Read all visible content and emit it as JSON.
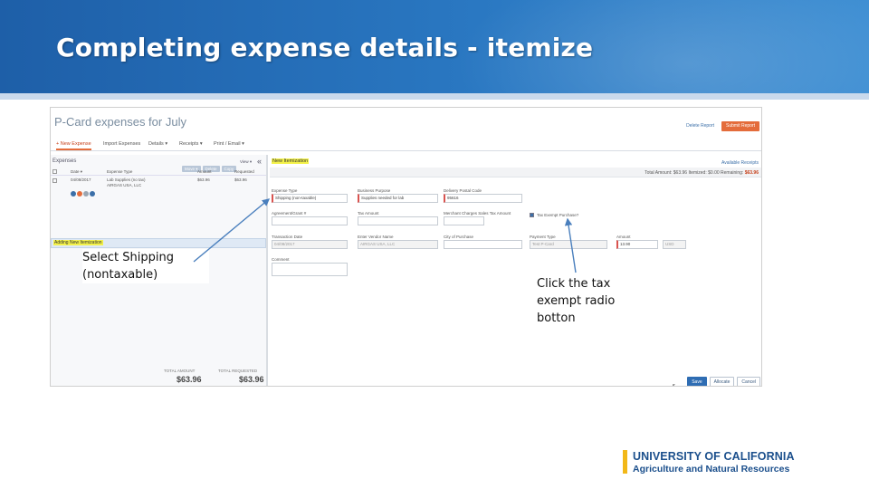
{
  "slide": {
    "title": "Completing expense details - itemize",
    "note_shipping": "Select Shipping\n(nontaxable)",
    "note_tax": "Click the tax\nexempt radio\nbotton"
  },
  "app": {
    "title": "P-Card expenses for July",
    "delete_report": "Delete Report",
    "submit_report": "Submit Report",
    "menu": [
      "+ New Expense",
      "Import Expenses",
      "Details ▾",
      "Receipts ▾",
      "Print / Email ▾"
    ]
  },
  "left_panel": {
    "heading": "Expenses",
    "buttons": [
      "Move ▾",
      "Delete",
      "Copy"
    ],
    "view": "View ▾",
    "collapse": "«",
    "columns": [
      "Date ▾",
      "Expense Type",
      "Amount",
      "Requested"
    ],
    "row": {
      "date": "04/08/2017",
      "type": "Lab Supplies (no tax)",
      "vendor": "AIRGAS USA, LLC",
      "amount": "$63.96",
      "requested": "$63.96"
    },
    "adding_label": "Adding New Itemization",
    "totals": {
      "total_amount_label": "TOTAL AMOUNT",
      "total_amount": "$63.96",
      "total_requested_label": "TOTAL REQUESTED",
      "total_requested": "$63.96"
    }
  },
  "right_panel": {
    "new_itemization": "New Itemization",
    "available_receipts": "Available Receipts",
    "totals_prefix": "Total Amount: $63.96  Itemized: $0.00  Remaining: ",
    "remaining": "$63.96",
    "fields": {
      "expense_type_label": "Expense Type",
      "expense_type_value": "Shipping (non-taxable)",
      "business_purpose_label": "Business Purpose",
      "business_purpose_value": "Supplies needed for lab",
      "delivery_postal_label": "Delivery Postal Code",
      "delivery_postal_value": "95616",
      "agreement_label": "Agreement/Grant #",
      "tax_amount_label": "Tax Amount",
      "merchant_tax_label": "Merchant Charges Sales Tax Amount",
      "tax_exempt_label": "Tax Exempt Purchase?",
      "transaction_date_label": "Transaction Date",
      "transaction_date_value": "04/08/2017",
      "vendor_label": "Enter Vendor Name",
      "vendor_value": "AIRGAS USA, LLC",
      "city_label": "City of Purchase",
      "payment_type_label": "Payment Type",
      "payment_type_value": "Test P-Card",
      "amount_label": "Amount",
      "amount_value": "13.90",
      "currency_value": "USD",
      "comment_label": "Comment"
    },
    "buttons": [
      "Save",
      "Allocate",
      "Cancel"
    ]
  },
  "logo": {
    "line1": "UNIVERSITY OF CALIFORNIA",
    "line2": "Agriculture and Natural Resources"
  },
  "colors": {
    "header_blue": "#2a78c2",
    "highlight_yellow": "#f4f24a",
    "submit_orange": "#e46c3b",
    "logo_gold": "#f2b818",
    "logo_blue": "#1b4f8c"
  }
}
